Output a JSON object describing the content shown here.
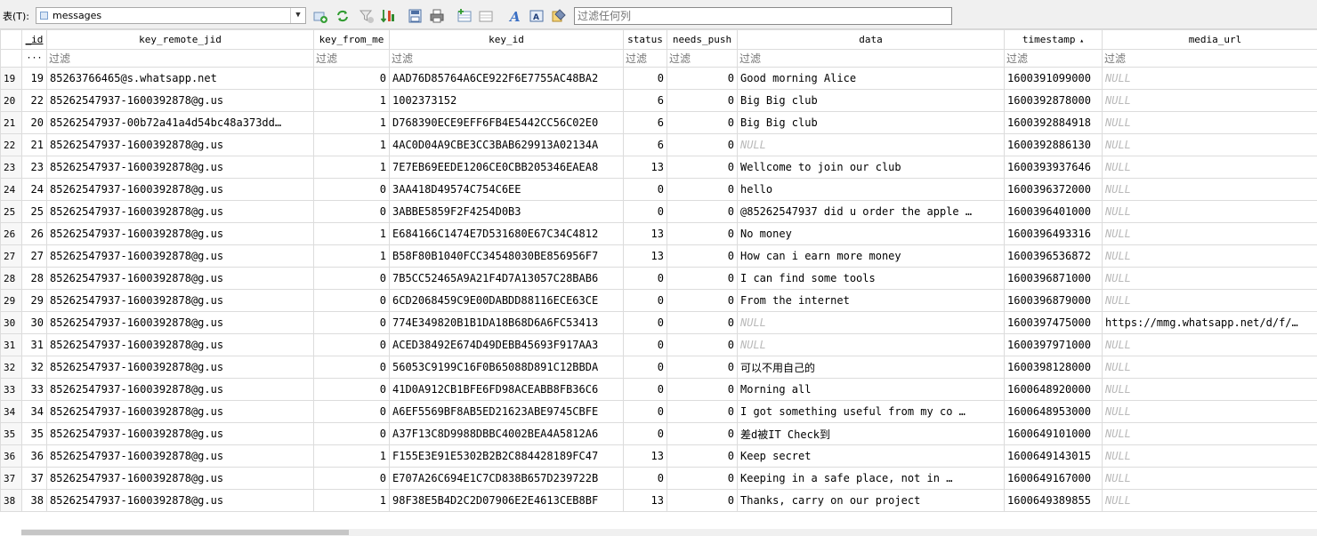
{
  "toolbar": {
    "table_label": "表(T):",
    "table_selected": "messages",
    "filter_placeholder": "过滤任何列",
    "icons": [
      "add-record-icon",
      "refresh-icon",
      "clear-filters-icon",
      "sort-icon",
      "save-filter-icon",
      "print-icon",
      "insert-row-icon",
      "delete-row-icon",
      "font-icon",
      "text-encoding-icon",
      "format-icon"
    ]
  },
  "grid": {
    "columns": [
      {
        "key": "_id",
        "label": "_id"
      },
      {
        "key": "key_remote_jid",
        "label": "key_remote_jid"
      },
      {
        "key": "key_from_me",
        "label": "key_from_me"
      },
      {
        "key": "key_id",
        "label": "key_id"
      },
      {
        "key": "status",
        "label": "status"
      },
      {
        "key": "needs_push",
        "label": "needs_push"
      },
      {
        "key": "data",
        "label": "data"
      },
      {
        "key": "timestamp",
        "label": "timestamp"
      },
      {
        "key": "media_url",
        "label": "media_url"
      }
    ],
    "sorted_column": "timestamp",
    "filter_corner_label": "···",
    "filter_placeholder": "过滤",
    "null_label": "NULL",
    "rows": [
      {
        "n": "19",
        "id": "19",
        "jid": "85263766465@s.whatsapp.net",
        "from_me": "0",
        "key_id": "AAD76D85764A6CE922F6E7755AC48BA2",
        "status": "0",
        "needs_push": "0",
        "data": "Good morning Alice",
        "timestamp": "1600391099000",
        "media_url": null
      },
      {
        "n": "20",
        "id": "22",
        "jid": "85262547937-1600392878@g.us",
        "from_me": "1",
        "key_id": "1002373152",
        "status": "6",
        "needs_push": "0",
        "data": "Big Big club",
        "timestamp": "1600392878000",
        "media_url": null
      },
      {
        "n": "21",
        "id": "20",
        "jid": "85262547937-00b72a41a4d54bc48a373dd…",
        "from_me": "1",
        "key_id": "D768390ECE9EFF6FB4E5442CC56C02E0",
        "status": "6",
        "needs_push": "0",
        "data": "Big Big club",
        "timestamp": "1600392884918",
        "media_url": null
      },
      {
        "n": "22",
        "id": "21",
        "jid": "85262547937-1600392878@g.us",
        "from_me": "1",
        "key_id": "4AC0D04A9CBE3CC3BAB629913A02134A",
        "status": "6",
        "needs_push": "0",
        "data": null,
        "timestamp": "1600392886130",
        "media_url": null
      },
      {
        "n": "23",
        "id": "23",
        "jid": "85262547937-1600392878@g.us",
        "from_me": "1",
        "key_id": "7E7EB69EEDE1206CE0CBB205346EAEA8",
        "status": "13",
        "needs_push": "0",
        "data": "Wellcome to join our club",
        "timestamp": "1600393937646",
        "media_url": null
      },
      {
        "n": "24",
        "id": "24",
        "jid": "85262547937-1600392878@g.us",
        "from_me": "0",
        "key_id": "3AA418D49574C754C6EE",
        "status": "0",
        "needs_push": "0",
        "data": "hello",
        "timestamp": "1600396372000",
        "media_url": null
      },
      {
        "n": "25",
        "id": "25",
        "jid": "85262547937-1600392878@g.us",
        "from_me": "0",
        "key_id": "3ABBE5859F2F4254D0B3",
        "status": "0",
        "needs_push": "0",
        "data": "@85262547937 did u order the apple …",
        "timestamp": "1600396401000",
        "media_url": null
      },
      {
        "n": "26",
        "id": "26",
        "jid": "85262547937-1600392878@g.us",
        "from_me": "1",
        "key_id": "E684166C1474E7D531680E67C34C4812",
        "status": "13",
        "needs_push": "0",
        "data": "No money",
        "timestamp": "1600396493316",
        "media_url": null
      },
      {
        "n": "27",
        "id": "27",
        "jid": "85262547937-1600392878@g.us",
        "from_me": "1",
        "key_id": "B58F80B1040FCC34548030BE856956F7",
        "status": "13",
        "needs_push": "0",
        "data": "How can i earn more money",
        "timestamp": "1600396536872",
        "media_url": null
      },
      {
        "n": "28",
        "id": "28",
        "jid": "85262547937-1600392878@g.us",
        "from_me": "0",
        "key_id": "7B5CC52465A9A21F4D7A13057C28BAB6",
        "status": "0",
        "needs_push": "0",
        "data": "I can find some tools",
        "timestamp": "1600396871000",
        "media_url": null
      },
      {
        "n": "29",
        "id": "29",
        "jid": "85262547937-1600392878@g.us",
        "from_me": "0",
        "key_id": "6CD2068459C9E00DABDD88116ECE63CE",
        "status": "0",
        "needs_push": "0",
        "data": "From the internet",
        "timestamp": "1600396879000",
        "media_url": null
      },
      {
        "n": "30",
        "id": "30",
        "jid": "85262547937-1600392878@g.us",
        "from_me": "0",
        "key_id": "774E349820B1B1DA18B68D6A6FC53413",
        "status": "0",
        "needs_push": "0",
        "data": null,
        "timestamp": "1600397475000",
        "media_url": "https://mmg.whatsapp.net/d/f/…"
      },
      {
        "n": "31",
        "id": "31",
        "jid": "85262547937-1600392878@g.us",
        "from_me": "0",
        "key_id": "ACED38492E674D49DEBB45693F917AA3",
        "status": "0",
        "needs_push": "0",
        "data": null,
        "timestamp": "1600397971000",
        "media_url": null
      },
      {
        "n": "32",
        "id": "32",
        "jid": "85262547937-1600392878@g.us",
        "from_me": "0",
        "key_id": "56053C9199C16F0B65088D891C12BBDA",
        "status": "0",
        "needs_push": "0",
        "data": "可以不用自己的",
        "timestamp": "1600398128000",
        "media_url": null
      },
      {
        "n": "33",
        "id": "33",
        "jid": "85262547937-1600392878@g.us",
        "from_me": "0",
        "key_id": "41D0A912CB1BFE6FD98ACEABB8FB36C6",
        "status": "0",
        "needs_push": "0",
        "data": "Morning all",
        "timestamp": "1600648920000",
        "media_url": null
      },
      {
        "n": "34",
        "id": "34",
        "jid": "85262547937-1600392878@g.us",
        "from_me": "0",
        "key_id": "A6EF5569BF8AB5ED21623ABE9745CBFE",
        "status": "0",
        "needs_push": "0",
        "data": "I got something useful from my co …",
        "timestamp": "1600648953000",
        "media_url": null
      },
      {
        "n": "35",
        "id": "35",
        "jid": "85262547937-1600392878@g.us",
        "from_me": "0",
        "key_id": "A37F13C8D9988DBBC4002BEA4A5812A6",
        "status": "0",
        "needs_push": "0",
        "data": "差d被IT Check到",
        "timestamp": "1600649101000",
        "media_url": null
      },
      {
        "n": "36",
        "id": "36",
        "jid": "85262547937-1600392878@g.us",
        "from_me": "1",
        "key_id": "F155E3E91E5302B2B2C884428189FC47",
        "status": "13",
        "needs_push": "0",
        "data": "Keep secret",
        "timestamp": "1600649143015",
        "media_url": null
      },
      {
        "n": "37",
        "id": "37",
        "jid": "85262547937-1600392878@g.us",
        "from_me": "0",
        "key_id": "E707A26C694E1C7CD838B657D239722B",
        "status": "0",
        "needs_push": "0",
        "data": "Keeping in a safe place, not in …",
        "timestamp": "1600649167000",
        "media_url": null
      },
      {
        "n": "38",
        "id": "38",
        "jid": "85262547937-1600392878@g.us",
        "from_me": "1",
        "key_id": "98F38E5B4D2C2D07906E2E4613CEB8BF",
        "status": "13",
        "needs_push": "0",
        "data": "Thanks, carry on our project",
        "timestamp": "1600649389855",
        "media_url": null
      }
    ]
  }
}
